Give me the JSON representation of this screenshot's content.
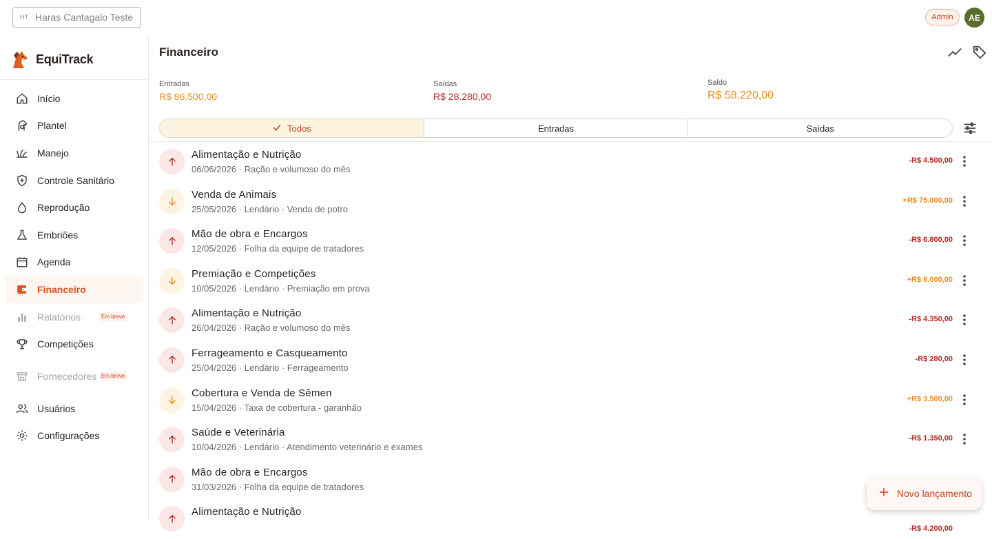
{
  "topbar": {
    "farm_initials": "HT",
    "farm_name": "Haras Cantagalo Teste",
    "role_badge": "Admin",
    "avatar_initials": "AE"
  },
  "brand": {
    "name": "EquiTrack",
    "logo_icon": "horse-head-icon"
  },
  "sidebar": {
    "items": [
      {
        "label": "Início",
        "icon": "home-icon"
      },
      {
        "label": "Plantel",
        "icon": "horse-icon"
      },
      {
        "label": "Manejo",
        "icon": "grass-icon"
      },
      {
        "label": "Controle Sanitário",
        "icon": "shield-plus-icon"
      },
      {
        "label": "Reprodução",
        "icon": "drop-icon"
      },
      {
        "label": "Embriões",
        "icon": "flask-icon"
      },
      {
        "label": "Agenda",
        "icon": "calendar-icon"
      },
      {
        "label": "Financeiro",
        "icon": "wallet-icon",
        "active": true
      },
      {
        "label": "Relatórios",
        "icon": "bar-chart-icon",
        "disabled": true,
        "badge": "Em breve"
      },
      {
        "label": "Competições",
        "icon": "trophy-icon"
      },
      {
        "label": "Fornecedores",
        "icon": "store-icon",
        "disabled": true,
        "badge": "Em breve"
      },
      {
        "label": "Usuários",
        "icon": "users-icon"
      },
      {
        "label": "Configurações",
        "icon": "gear-icon"
      }
    ]
  },
  "page": {
    "title": "Financeiro",
    "summary": {
      "entradas_label": "Entradas",
      "entradas_value": "R$ 86.500,00",
      "saidas_label": "Saídas",
      "saidas_value": "R$ 28.280,00",
      "saldo_label": "Saldo",
      "saldo_value": "R$ 58.220,00"
    },
    "tabs": [
      {
        "label": "Todos",
        "active": true
      },
      {
        "label": "Entradas"
      },
      {
        "label": "Saídas"
      }
    ]
  },
  "transactions": [
    {
      "type": "out",
      "title": "Alimentação e Nutrição",
      "subtitle": "06/06/2026 · Ração e volumoso do mês",
      "amount": "-R$ 4.500,00"
    },
    {
      "type": "in",
      "title": "Venda de Animais",
      "subtitle": "25/05/2026 · Lendário · Venda de potro",
      "amount": "+R$ 75.000,00"
    },
    {
      "type": "out",
      "title": "Mão de obra e Encargos",
      "subtitle": "12/05/2026 · Folha da equipe de tratadores",
      "amount": "-R$ 6.800,00"
    },
    {
      "type": "in",
      "title": "Premiação e Competições",
      "subtitle": "10/05/2026 · Lendário · Premiação em prova",
      "amount": "+R$ 8.000,00"
    },
    {
      "type": "out",
      "title": "Alimentação e Nutrição",
      "subtitle": "26/04/2026 · Ração e volumoso do mês",
      "amount": "-R$ 4.350,00"
    },
    {
      "type": "out",
      "title": "Ferrageamento e Casqueamento",
      "subtitle": "25/04/2026 · Lendário · Ferrageamento",
      "amount": "-R$ 280,00"
    },
    {
      "type": "in",
      "title": "Cobertura e Venda de Sêmen",
      "subtitle": "15/04/2026 · Taxa de cobertura - garanhão",
      "amount": "+R$ 3.500,00"
    },
    {
      "type": "out",
      "title": "Saúde e Veterinária",
      "subtitle": "10/04/2026 · Lendário · Atendimento veterinário e exames",
      "amount": "-R$ 1.350,00"
    },
    {
      "type": "out",
      "title": "Mão de obra e Encargos",
      "subtitle": "31/03/2026 · Folha da equipe de tratadores",
      "amount": ""
    },
    {
      "type": "out",
      "title": "Alimentação e Nutrição",
      "subtitle": "",
      "amount": "-R$ 4.200,00"
    }
  ],
  "fab": {
    "label": "Novo lançamento"
  },
  "colors": {
    "accent": "#e0501d",
    "income": "#e98b1c",
    "expense": "#b3261e"
  }
}
